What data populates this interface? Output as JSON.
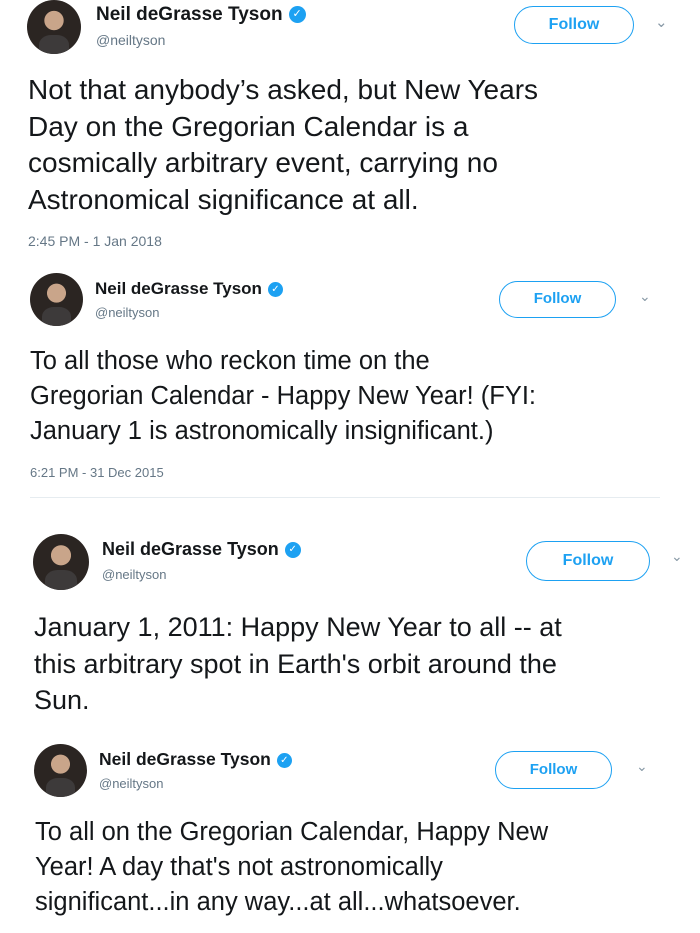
{
  "tweets": [
    {
      "name": "Neil deGrasse Tyson",
      "handle": "@neiltyson",
      "follow_label": "Follow",
      "chevron_icon": "chevron-down-icon",
      "verified_icon": "verified-badge-icon",
      "lines": [
        "Not that anybody’s asked, but New Years",
        "Day on the Gregorian Calendar is a",
        "cosmically arbitrary event, carrying no",
        "Astronomical significance at all."
      ],
      "timestamp": "2:45 PM - 1 Jan 2018"
    },
    {
      "name": "Neil deGrasse Tyson",
      "handle": "@neiltyson",
      "follow_label": "Follow",
      "chevron_icon": "chevron-down-icon",
      "verified_icon": "verified-badge-icon",
      "lines": [
        "To all those who reckon time on the",
        "Gregorian Calendar - Happy New Year!  (FYI:",
        "January 1 is astronomically  insignificant.)"
      ],
      "timestamp": "6:21 PM - 31 Dec 2015"
    },
    {
      "name": "Neil deGrasse Tyson",
      "handle": "@neiltyson",
      "follow_label": "Follow",
      "chevron_icon": "chevron-down-icon",
      "verified_icon": "verified-badge-icon",
      "lines": [
        "January 1, 2011: Happy New Year to all -- at",
        "this arbitrary spot in Earth's orbit around the",
        "Sun."
      ]
    },
    {
      "name": "Neil deGrasse Tyson",
      "handle": "@neiltyson",
      "follow_label": "Follow",
      "chevron_icon": "chevron-down-icon",
      "verified_icon": "verified-badge-icon",
      "lines": [
        "To all on the Gregorian Calendar, Happy New",
        "Year! A day that's not astronomically",
        "significant...in any way...at all...whatsoever."
      ]
    }
  ],
  "colors": {
    "twitter_blue": "#1da1f2",
    "text": "#14171a",
    "secondary_text": "#657786"
  }
}
